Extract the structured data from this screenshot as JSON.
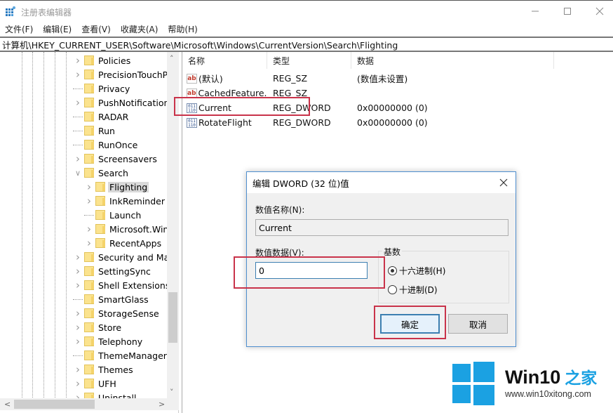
{
  "window": {
    "title": "注册表编辑器",
    "minimize_icon": "minimize-icon",
    "maximize_icon": "maximize-icon",
    "close_icon": "close-icon"
  },
  "menu": [
    "文件(F)",
    "编辑(E)",
    "查看(V)",
    "收藏夹(A)",
    "帮助(H)"
  ],
  "address": "计算机\\HKEY_CURRENT_USER\\Software\\Microsoft\\Windows\\CurrentVersion\\Search\\Flighting",
  "tree": {
    "items": [
      {
        "label": "Policies",
        "level": 0,
        "expander": "collapsed"
      },
      {
        "label": "PrecisionTouchPa",
        "level": 0,
        "expander": "collapsed"
      },
      {
        "label": "Privacy",
        "level": 0,
        "expander": "none"
      },
      {
        "label": "PushNotifications",
        "level": 0,
        "expander": "collapsed"
      },
      {
        "label": "RADAR",
        "level": 0,
        "expander": "none"
      },
      {
        "label": "Run",
        "level": 0,
        "expander": "none"
      },
      {
        "label": "RunOnce",
        "level": 0,
        "expander": "none"
      },
      {
        "label": "Screensavers",
        "level": 0,
        "expander": "collapsed"
      },
      {
        "label": "Search",
        "level": 0,
        "expander": "expanded"
      },
      {
        "label": "Flighting",
        "level": 1,
        "expander": "collapsed",
        "selected": true
      },
      {
        "label": "InkReminder",
        "level": 1,
        "expander": "collapsed"
      },
      {
        "label": "Launch",
        "level": 1,
        "expander": "none"
      },
      {
        "label": "Microsoft.Wind",
        "level": 1,
        "expander": "collapsed"
      },
      {
        "label": "RecentApps",
        "level": 1,
        "expander": "collapsed"
      },
      {
        "label": "Security and Mai",
        "level": 0,
        "expander": "collapsed"
      },
      {
        "label": "SettingSync",
        "level": 0,
        "expander": "collapsed"
      },
      {
        "label": "Shell Extensions",
        "level": 0,
        "expander": "collapsed"
      },
      {
        "label": "SmartGlass",
        "level": 0,
        "expander": "none"
      },
      {
        "label": "StorageSense",
        "level": 0,
        "expander": "collapsed"
      },
      {
        "label": "Store",
        "level": 0,
        "expander": "collapsed"
      },
      {
        "label": "Telephony",
        "level": 0,
        "expander": "collapsed"
      },
      {
        "label": "ThemeManager",
        "level": 0,
        "expander": "none"
      },
      {
        "label": "Themes",
        "level": 0,
        "expander": "collapsed"
      },
      {
        "label": "UFH",
        "level": 0,
        "expander": "collapsed"
      },
      {
        "label": "Uninstall",
        "level": 0,
        "expander": "collapsed"
      }
    ]
  },
  "list": {
    "columns": [
      "名称",
      "类型",
      "数据"
    ],
    "rows": [
      {
        "icon": "string-value-icon",
        "name": "(默认)",
        "type": "REG_SZ",
        "data": "(数值未设置)"
      },
      {
        "icon": "string-value-icon",
        "name": "CachedFeature...",
        "type": "REG_SZ",
        "data": ""
      },
      {
        "icon": "dword-value-icon",
        "name": "Current",
        "type": "REG_DWORD",
        "data": "0x00000000 (0)",
        "highlighted": true
      },
      {
        "icon": "dword-value-icon",
        "name": "RotateFlight",
        "type": "REG_DWORD",
        "data": "0x00000000 (0)"
      }
    ]
  },
  "dialog": {
    "title": "编辑 DWORD (32 位)值",
    "name_label": "数值名称(N):",
    "name_value": "Current",
    "data_label": "数值数据(V):",
    "data_value": "0",
    "base_label": "基数",
    "base_options": [
      {
        "label": "十六进制(H)",
        "checked": true
      },
      {
        "label": "十进制(D)",
        "checked": false
      }
    ],
    "ok_label": "确定",
    "cancel_label": "取消"
  },
  "watermark": {
    "brand": "Win10",
    "brand_cn": "之家",
    "url": "www.win10xitong.com",
    "color": "#1ba1e2"
  },
  "colors": {
    "annotation_red": "#c9334a",
    "focus_blue": "#3c7fb1"
  }
}
